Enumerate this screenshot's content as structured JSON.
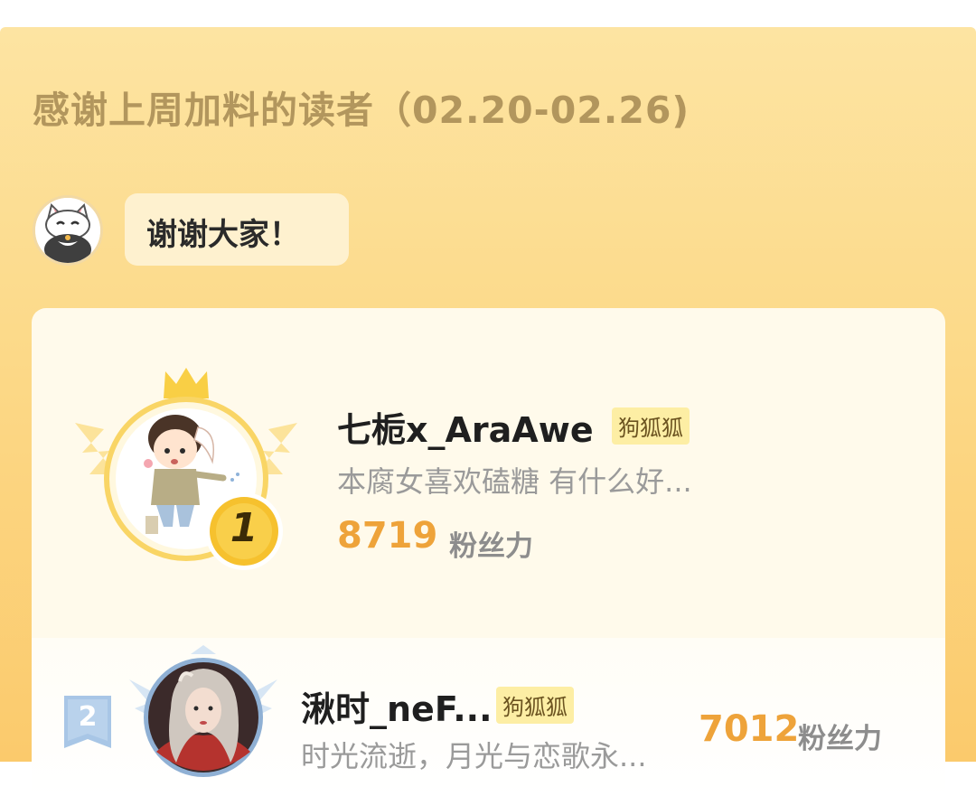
{
  "header": {
    "title": "感谢上周加料的读者（02.20-02.26)"
  },
  "greeting": {
    "message": "谢谢大家！",
    "avatar_icon": "cat-mascot-icon"
  },
  "ranking": [
    {
      "rank": "1",
      "name": "七栀x_AraAwe",
      "tag": "狗狐狐",
      "bio": "本腐女喜欢磕糖 有什么好...",
      "score": "8719",
      "unit": "粉丝力"
    },
    {
      "rank": "2",
      "name": "湫时_neF...",
      "tag": "狗狐狐",
      "bio": "时光流逝，月光与恋歌永...",
      "score": "7012",
      "unit": "粉丝力"
    }
  ],
  "colors": {
    "panel_top": "#fde4a2",
    "panel_bottom": "#fbca6c",
    "title_text": "#b2965d",
    "score_text": "#eea33a",
    "tag_bg": "#fdeea4",
    "gold_badge": "#f5c02c",
    "silver_badge": "#9fc0e2"
  }
}
